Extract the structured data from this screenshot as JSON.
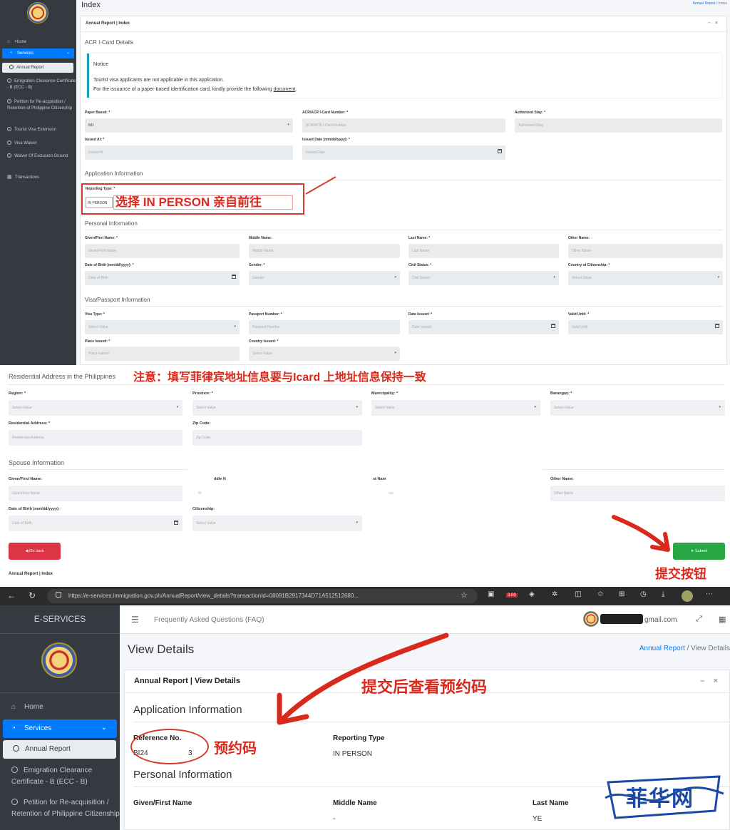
{
  "top": {
    "page_title": "Index",
    "breadcrumb": {
      "parent": "Annual Report",
      "current": "Index"
    },
    "sidebar": {
      "home": "Home",
      "services": "Services",
      "items": [
        "Annual Report",
        "Emigration Clearance Certificate - B (ECC - B)",
        "Petition for Re-acquisition / Retention of Philippine Citizenship",
        "Tourist Visa Extension",
        "Visa Waiver",
        "Waiver Of Exclusion Ground"
      ],
      "transactions": "Transactions"
    },
    "card_title": "Annual Report | Index",
    "acr_section": "ACR I-Card Details",
    "notice": {
      "title": "Notice",
      "line1": "Tourist visa applicants are not applicable in this application.",
      "line2": "For the issuance of a paper-based identification card, kindly provide the following",
      "link": "document",
      "end": "."
    },
    "fields": {
      "paper_based": {
        "label": "Paper Based: *",
        "value": "NO"
      },
      "acr_number": {
        "label": "ACR/ACR I-Card Number: *",
        "placeholder": "ACR/ACR I-Card Number"
      },
      "authorized_stay": {
        "label": "Authorized Stay: *",
        "placeholder": "Authorized Stay"
      },
      "issued_at": {
        "label": "Issued At: *",
        "placeholder": "Issued At"
      },
      "issued_date": {
        "label": "Issued Date (mm/dd/yyyy): *",
        "placeholder": "Issued Date"
      }
    },
    "application_section": "Application Information",
    "reporting_type": {
      "label": "Reporting Type: *",
      "value": "IN PERSON"
    },
    "reporting_annotation": "选择 IN PERSON 亲自前往",
    "personal_section": "Personal Information",
    "personal": {
      "given": {
        "label": "Given/First Name: *",
        "placeholder": "Given/First Name"
      },
      "middle": {
        "label": "Middle Name:",
        "placeholder": "Middle Name"
      },
      "last": {
        "label": "Last Name: *",
        "placeholder": "Last Name"
      },
      "other": {
        "label": "Other Name:",
        "placeholder": "Other Name"
      },
      "dob": {
        "label": "Date of Birth (mm/dd/yyyy): *",
        "placeholder": "Date of Birth"
      },
      "gender": {
        "label": "Gender: *",
        "placeholder": "Gender"
      },
      "civil": {
        "label": "Civil Status: *",
        "placeholder": "Civil Status"
      },
      "citizenship": {
        "label": "Country of Citizenship: *",
        "placeholder": "Select Value"
      }
    },
    "visa_section": "Visa/Passport Information",
    "visa": {
      "visa_type": {
        "label": "Visa Type: *",
        "placeholder": "Select Value"
      },
      "passport": {
        "label": "Passport Number: *",
        "placeholder": "Passport Number"
      },
      "date_issued": {
        "label": "Date Issued: *",
        "placeholder": "Date Issued"
      },
      "valid_until": {
        "label": "Valid Until: *",
        "placeholder": "Valid Until"
      },
      "place_issued": {
        "label": "Place Issued: *",
        "placeholder": "Place Issued"
      },
      "country_issued": {
        "label": "Country Issued: *",
        "placeholder": "Select Value"
      }
    }
  },
  "mid": {
    "address_section": "Residential Address in the Philippines",
    "address_annotation": "注意：填写菲律宾地址信息要与Icard 上地址信息保持一致",
    "address": {
      "region": {
        "label": "Region: *",
        "placeholder": "Select Value"
      },
      "province": {
        "label": "Province: *",
        "placeholder": "Select Value"
      },
      "municipality": {
        "label": "Municipality: *",
        "placeholder": "Select Value"
      },
      "barangay": {
        "label": "Barangay: *",
        "placeholder": "Select Value"
      },
      "residential": {
        "label": "Residential Address: *",
        "placeholder": "Residential Address"
      },
      "zip": {
        "label": "Zip Code:",
        "placeholder": "Zip Code"
      }
    },
    "spouse_section": "Spouse Information",
    "spouse": {
      "given": {
        "label": "Given/First Name:",
        "placeholder": "Given/First Name"
      },
      "middle": {
        "label": "ddle N",
        "placeholder": "M"
      },
      "last": {
        "label": "st Nam",
        "placeholder": "me"
      },
      "other": {
        "label": "Other Name:",
        "placeholder": "Other Name"
      },
      "dob": {
        "label": "Date of Birth (mm/dd/yyyy):",
        "placeholder": "Date of Birth"
      },
      "citizenship": {
        "label": "Citizenship:",
        "placeholder": "Select Value"
      }
    },
    "go_back": "Go back",
    "submit": "Submit",
    "submit_annotation": "提交按钮",
    "footer_title": "Annual Report | Index"
  },
  "browser": {
    "url": "https://e-services.immigration.gov.ph/AnnualReport/view_details?transactionId=08091B2917344D71A512512680...",
    "badge": "3.00"
  },
  "bottom": {
    "brand": "E-SERVICES",
    "faq": "Frequently Asked Questions (FAQ)",
    "email": "gmail.com",
    "sidebar": {
      "home": "Home",
      "services": "Services",
      "items": [
        "Annual Report",
        "Emigration Clearance Certificate - B (ECC - B)",
        "Petition for Re-acquisition / Retention of Philippine Citizenship"
      ]
    },
    "page_title": "View Details",
    "breadcrumb": {
      "parent": "Annual Report",
      "current": "View Details"
    },
    "card_title": "Annual Report | View Details",
    "view_annotation": "提交后查看预约码",
    "application_section": "Application Information",
    "reference": {
      "label": "Reference No.",
      "value_start": "BI24",
      "value_end": "3"
    },
    "reference_annotation": "预约码",
    "reporting": {
      "label": "Reporting Type",
      "value": "IN PERSON"
    },
    "personal_section": "Personal Information",
    "given_label": "Given/First Name",
    "middle_label": "Middle Name",
    "middle_value": "-",
    "last_label": "Last Name",
    "last_value": "YE"
  },
  "watermark": "菲华网",
  "colors": {
    "primary": "#007bff",
    "danger": "#dc3545",
    "success": "#28a745",
    "annotation": "#d9291c",
    "sidebar": "#343a40",
    "watermark": "#1b4aa6"
  }
}
